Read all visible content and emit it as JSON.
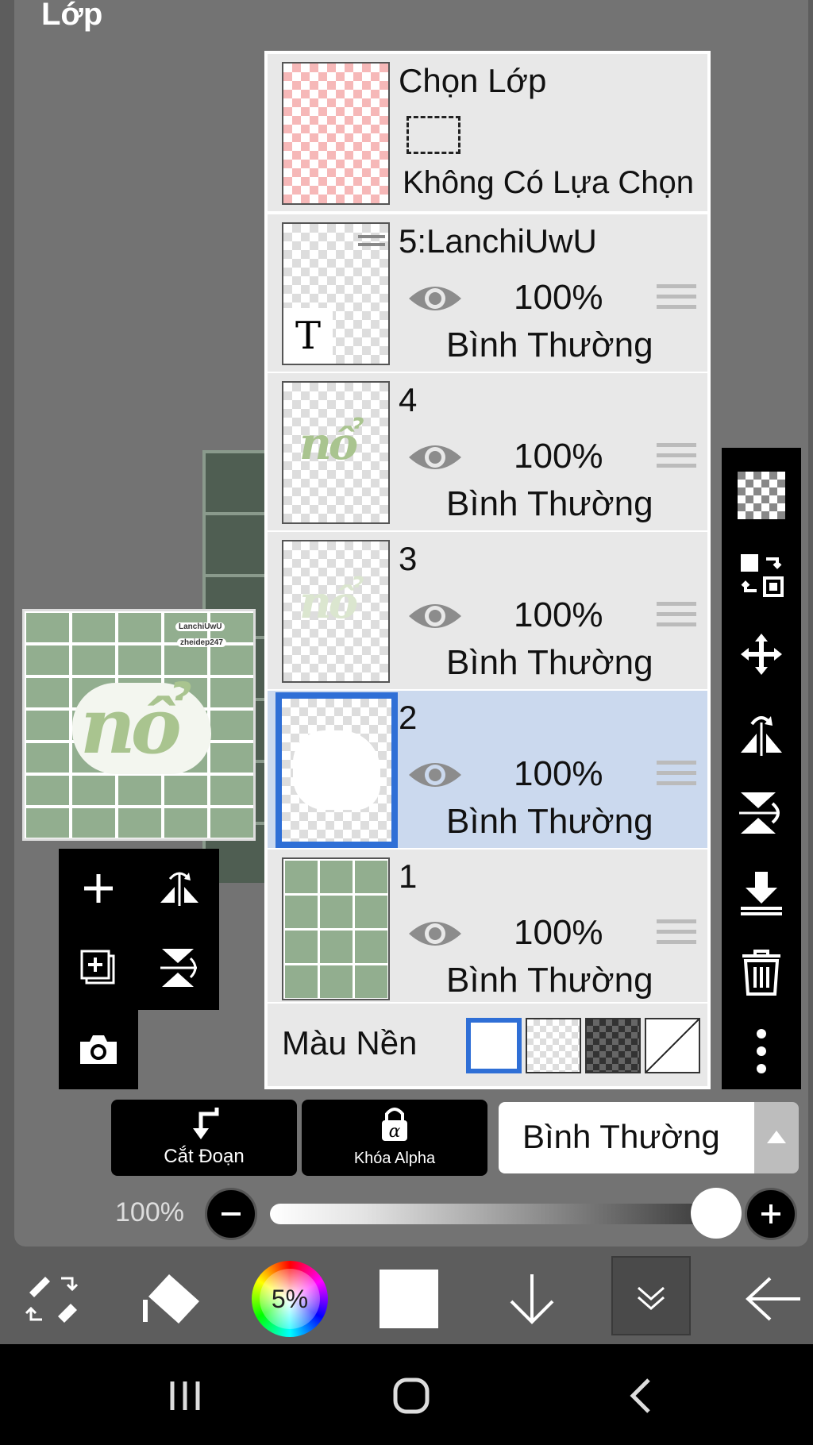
{
  "app": {
    "title": "Lớp"
  },
  "preview": {
    "overlay_text": "nổ",
    "tag_line1": "LanchiUwU",
    "tag_line2": "zheidep247"
  },
  "selection": {
    "title": "Chọn Lớp",
    "status": "Không Có Lựa Chọn"
  },
  "layers": [
    {
      "name": "5:LanchiUwU",
      "opacity": "100%",
      "blend": "Bình Thường",
      "visible": true,
      "thumb": "text-layer",
      "selected": false
    },
    {
      "name": "4",
      "opacity": "100%",
      "blend": "Bình Thường",
      "visible": true,
      "thumb": "art-green",
      "selected": false
    },
    {
      "name": "3",
      "opacity": "100%",
      "blend": "Bình Thường",
      "visible": true,
      "thumb": "art-faint",
      "selected": false
    },
    {
      "name": "2",
      "opacity": "100%",
      "blend": "Bình Thường",
      "visible": true,
      "thumb": "white-blob",
      "selected": true
    },
    {
      "name": "1",
      "opacity": "100%",
      "blend": "Bình Thường",
      "visible": true,
      "thumb": "green-grid",
      "selected": false
    }
  ],
  "background": {
    "label": "Màu Nền",
    "options": [
      "white",
      "transparent",
      "dark-checker",
      "none"
    ],
    "selected": "white"
  },
  "options": {
    "clip_label": "Cắt Đoạn",
    "alpha_lock_label": "Khóa Alpha",
    "blend_mode": "Bình Thường",
    "opacity_label": "100%",
    "opacity_value": 1.0
  },
  "bottom_toolbar": {
    "color_percent": "5%"
  },
  "colors": {
    "accent": "#2f6fd6",
    "selected_row": "#cbd9ee",
    "panel": "#e8e8e8"
  }
}
